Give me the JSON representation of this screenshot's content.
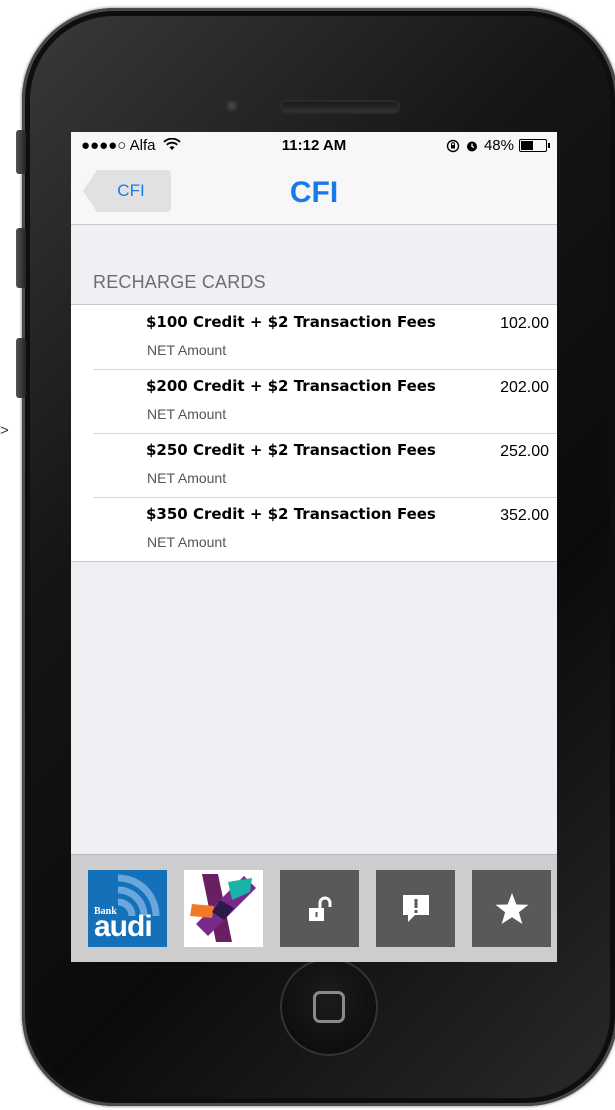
{
  "status_bar": {
    "carrier": "●●●●○ Alfa",
    "time": "11:12 AM",
    "battery": "48%",
    "battery_level": 0.48
  },
  "nav": {
    "back_label": "CFI",
    "title": "CFI"
  },
  "section": {
    "header": "RECHARGE CARDS"
  },
  "cards": [
    {
      "title": "$100 Credit + $2 Transaction Fees",
      "subtitle": "NET Amount",
      "amount": "102.00"
    },
    {
      "title": "$200 Credit + $2 Transaction Fees",
      "subtitle": "NET Amount",
      "amount": "202.00"
    },
    {
      "title": "$250 Credit + $2 Transaction Fees",
      "subtitle": "NET Amount",
      "amount": "252.00"
    },
    {
      "title": "$350 Credit + $2 Transaction Fees",
      "subtitle": "NET Amount",
      "amount": "352.00"
    }
  ],
  "tab_bar": {
    "bank_logo_text": "audi",
    "bank_logo_small": "Bank",
    "icons": [
      "bank-audi-logo",
      "colorful-star-logo",
      "unlock-icon",
      "alert-message-icon",
      "star-icon"
    ]
  },
  "page": {
    "side_arrow": ">"
  },
  "colors": {
    "accent": "#1a7ae8",
    "tile_dark": "#595959",
    "audi_blue": "#1470b9"
  }
}
